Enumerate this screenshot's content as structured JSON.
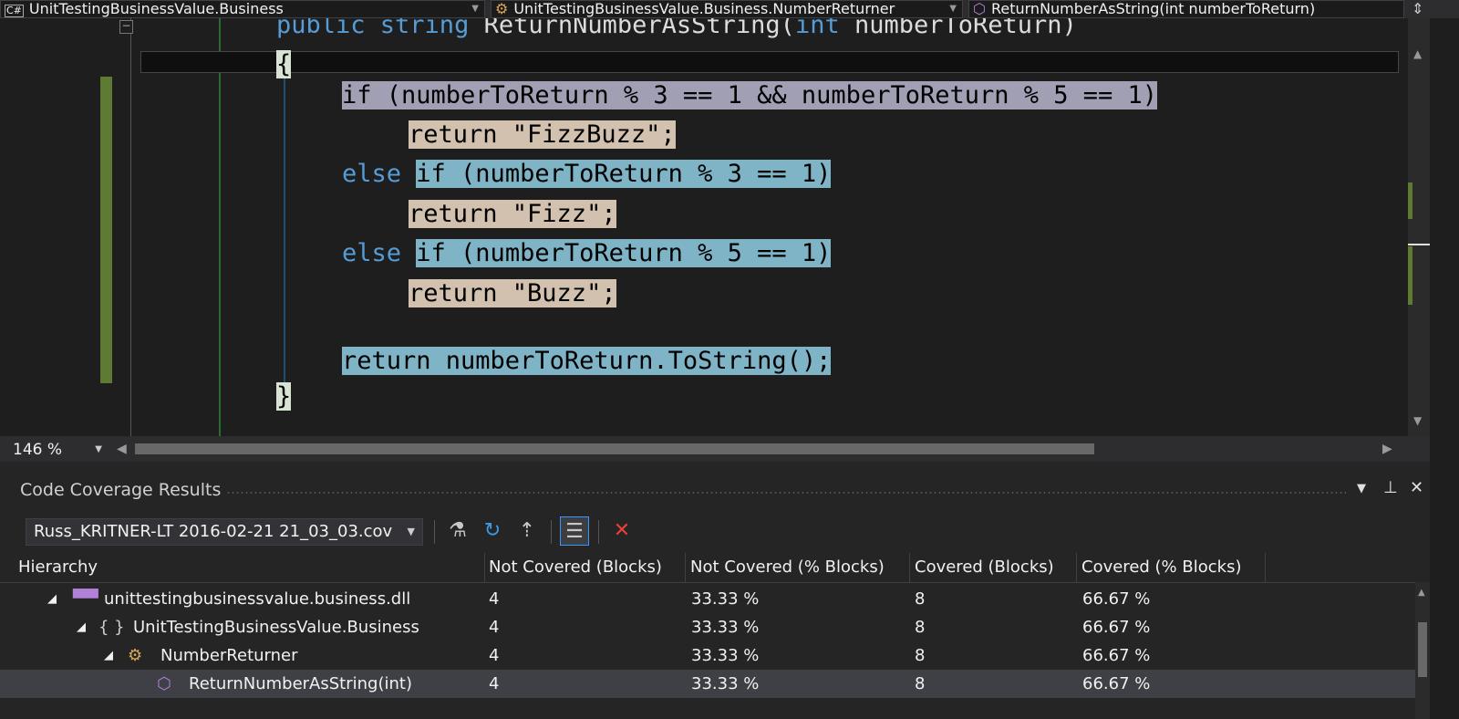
{
  "navbar": {
    "project": "UnitTestingBusinessValue.Business",
    "project_icon": "C#",
    "type": "UnitTestingBusinessValue.Business.NumberReturner",
    "member": "ReturnNumberAsString(int numberToReturn)"
  },
  "code": {
    "lines": [
      {
        "parts": [
          {
            "text": "public string ReturnNumberAsString(int numberToReturn)",
            "cls": ""
          }
        ]
      },
      {
        "parts": [
          {
            "text": "{",
            "cls": "hl-brace"
          }
        ]
      },
      {
        "parts": [
          {
            "text": "if (numberToReturn % 3 == 1 && numberToReturn % 5 == 1)",
            "cls": "hl-purple"
          }
        ]
      },
      {
        "parts": [
          {
            "text": "return \"FizzBuzz\";",
            "cls": "hl-tan"
          }
        ]
      },
      {
        "parts": [
          {
            "text": "else ",
            "cls": "kw"
          },
          {
            "text": "if (numberToReturn % 3 == 1)",
            "cls": "hl-blue"
          }
        ]
      },
      {
        "parts": [
          {
            "text": "return \"Fizz\";",
            "cls": "hl-tan"
          }
        ]
      },
      {
        "parts": [
          {
            "text": "else ",
            "cls": "kw"
          },
          {
            "text": "if (numberToReturn % 5 == 1)",
            "cls": "hl-blue"
          }
        ]
      },
      {
        "parts": [
          {
            "text": "return \"Buzz\";",
            "cls": "hl-tan"
          }
        ]
      },
      {
        "parts": [
          {
            "text": "return numberToReturn.ToString();",
            "cls": "hl-blue"
          }
        ]
      },
      {
        "parts": [
          {
            "text": "}",
            "cls": "hl-brace"
          }
        ]
      }
    ]
  },
  "zoom": "146 %",
  "panel": {
    "title": "Code Coverage Results",
    "result_file": "Russ_KRITNER-LT 2016-02-21 21_03_03.cov"
  },
  "table": {
    "columns": [
      "Hierarchy",
      "Not Covered (Blocks)",
      "Not Covered (% Blocks)",
      "Covered (Blocks)",
      "Covered (% Blocks)"
    ],
    "rows": [
      {
        "name": "unittestingbusinessvalue.business.dll",
        "icon": "assembly-icon",
        "not_covered_blocks": "4",
        "not_covered_pct": "33.33 %",
        "covered_blocks": "8",
        "covered_pct": "66.67 %"
      },
      {
        "name": "UnitTestingBusinessValue.Business",
        "icon": "namespace-icon",
        "not_covered_blocks": "4",
        "not_covered_pct": "33.33 %",
        "covered_blocks": "8",
        "covered_pct": "66.67 %"
      },
      {
        "name": "NumberReturner",
        "icon": "class-icon",
        "not_covered_blocks": "4",
        "not_covered_pct": "33.33 %",
        "covered_blocks": "8",
        "covered_pct": "66.67 %"
      },
      {
        "name": "ReturnNumberAsString(int)",
        "icon": "method-icon",
        "not_covered_blocks": "4",
        "not_covered_pct": "33.33 %",
        "covered_blocks": "8",
        "covered_pct": "66.67 %"
      }
    ]
  },
  "colors": {
    "editor_bg": "#1e1e1e",
    "accent": "#3399ff",
    "covered_highlight": "#7fb3c6",
    "partial_highlight": "#a19fb3",
    "not_covered_highlight": "#d2c1ae",
    "change_bar": "#5f7a32"
  }
}
